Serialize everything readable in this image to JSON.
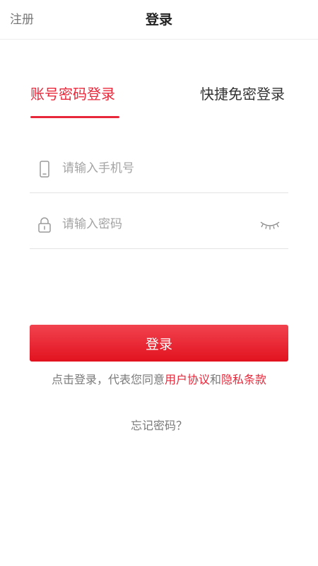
{
  "header": {
    "left_action": "注册",
    "title": "登录"
  },
  "tabs": [
    {
      "label": "账号密码登录",
      "active": true
    },
    {
      "label": "快捷免密登录",
      "active": false
    }
  ],
  "form": {
    "phone": {
      "value": "",
      "placeholder": "请输入手机号",
      "icon": "phone-icon"
    },
    "password": {
      "value": "",
      "placeholder": "请输入密码",
      "icon": "lock-icon",
      "toggle_icon": "eye-closed-icon"
    }
  },
  "login_button": {
    "label": "登录"
  },
  "agreement": {
    "prefix": "点击登录，代表您同意",
    "user_agreement": "用户协议",
    "conjunction": "和",
    "privacy_policy": "隐私条款"
  },
  "forgot_password": "忘记密码？",
  "colors": {
    "accent": "#e8283a",
    "button_gradient_top": "#f1434f",
    "button_gradient_bottom": "#e2121f"
  }
}
